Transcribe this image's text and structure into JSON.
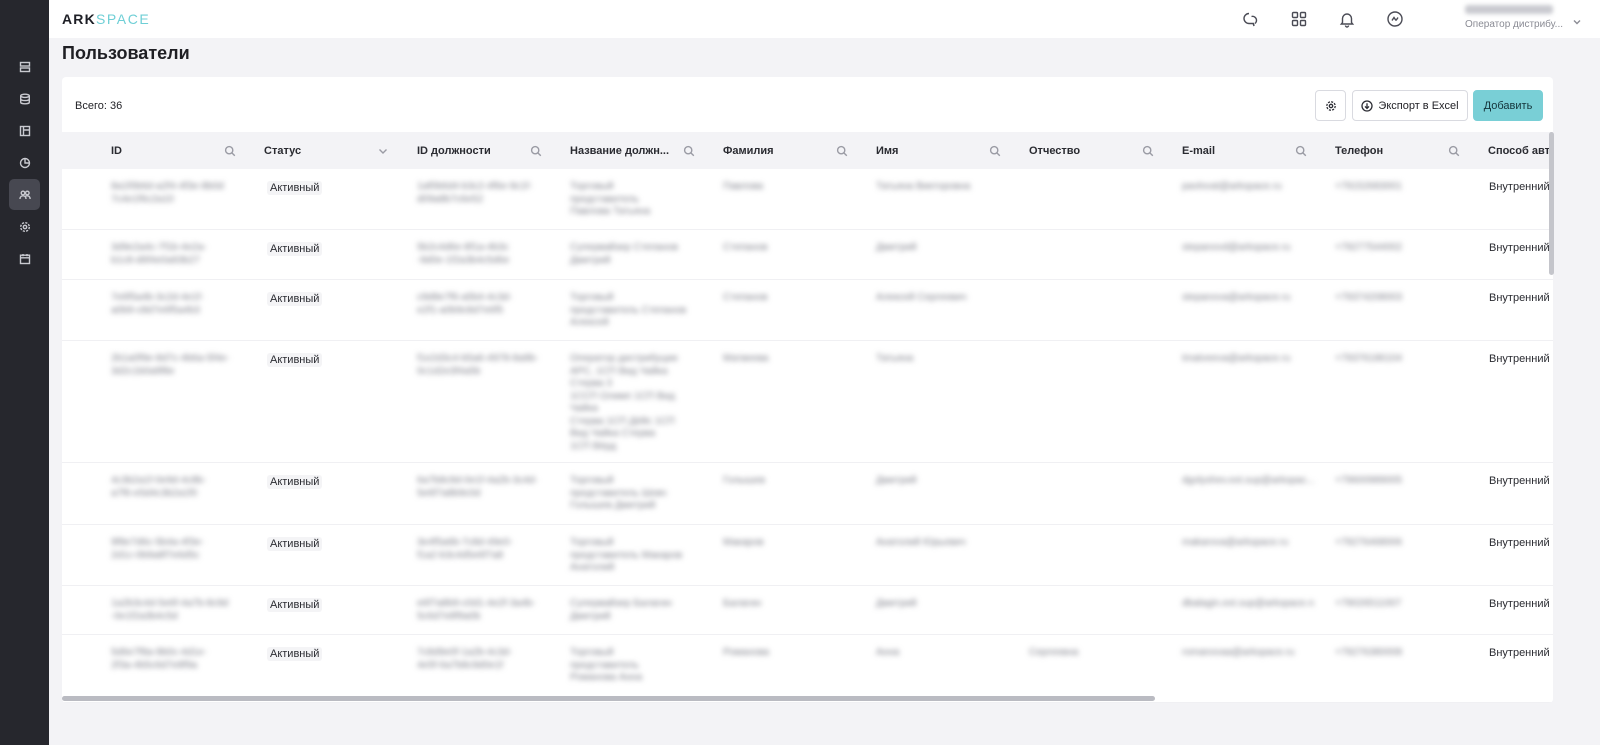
{
  "app": {
    "logo_part1": "ARK",
    "logo_part2": "SPACE",
    "accent": "#6fcfd6"
  },
  "sidebar": {
    "items": [
      {
        "icon": "servers-icon",
        "active": false
      },
      {
        "icon": "database-icon",
        "active": false
      },
      {
        "icon": "layout-icon",
        "active": false
      },
      {
        "icon": "pie-chart-icon",
        "active": false
      },
      {
        "icon": "users-icon",
        "active": true
      },
      {
        "icon": "settings-icon",
        "active": false
      },
      {
        "icon": "calendar-icon",
        "active": false
      }
    ]
  },
  "header": {
    "icons": [
      "chat-icon",
      "apps-grid-icon",
      "bell-icon",
      "sync-icon",
      "chevron-down-icon"
    ],
    "user_role": "Оператор дистрибу..."
  },
  "page": {
    "title": "Пользователи",
    "total": "Всего: 36"
  },
  "toolbar": {
    "export_label": "Экспорт в Excel",
    "add_label": "Добавить"
  },
  "table": {
    "columns": [
      "ID",
      "Статус",
      "ID должности",
      "Название должн...",
      "Фамилия",
      "Имя",
      "Отчество",
      "E-mail",
      "Телефон",
      "Способ авто"
    ],
    "rows": [
      {
        "id": "8a1f0b6d-a2f4-4f3e-8b0d\n7c4e1f6c2a10",
        "status": "Активный",
        "pos_id": "1af0b6d4-b3c2-4f6e-9c1f-\nd09a8b7c6e52",
        "pos_name": "Торговый\nпредставитель\nПавлова Татьяна",
        "last": "Павлова",
        "first": "Татьяна Викторовна",
        "middle": "",
        "email": "pavlovat@arkspace.ru",
        "phone": "+79152683001",
        "auth": "Внутренний"
      },
      {
        "id": "3d9e2a4c-7f1b-4e2a-\nb1c8-d6f4e0a93b27",
        "status": "Активный",
        "pos_id": "5b2c4d6e-8f1a-4b3c\n-9d0e-1f2a3b4c5d6e",
        "pos_name": "Супервайзер Степанов\nДмитрий",
        "last": "Степанов",
        "first": "Дмитрий",
        "middle": "",
        "email": "stepanovd@arkspace.ru",
        "phone": "+79277544002",
        "auth": "Внутренний"
      },
      {
        "id": "7e6f5a4b-3c2d-4e1f-\na0b9-c8d7e6f5a4b3",
        "status": "Активный",
        "pos_id": "c9d8e7f6-a5b4-4c3d-\ne2f1-a0b9c8d7e6f5",
        "pos_name": "Торговый\nпредставитель Степанов\nАлексей",
        "last": "Степанов",
        "first": "Алексей Сергеевич",
        "middle": "",
        "email": "stepanova@arkspace.ru",
        "phone": "+79374208003",
        "auth": "Внутренний"
      },
      {
        "id": "2b1a0f9e-8d7c-4b6a-5f4e-\n3d2c1b0a9f8e",
        "status": "Активный",
        "pos_id": "f1e2d3c4-b5a6-4978-8a9b-\n0c1d2e3f4a5b",
        "pos_name": "Оператор дистрибуции\nАРС, 1СП Вид Чайка\nСтерва 3\n1ССП Олимп 1СП Вид\nЧайка\nСтерва 1СП Дёйс 1СП\nВид Чайка Стерва\n1СП Вёрд",
        "last": "Матвеева",
        "first": "Татьяна",
        "middle": "",
        "email": "tmatveeva@arkspace.ru",
        "phone": "+79376186104",
        "auth": "Внутренний"
      },
      {
        "id": "4c3b2a1f-0e9d-4c8b-\na7f6-e5d4c3b2a1f0",
        "status": "Активный",
        "pos_id": "6a7b8c9d-0e1f-4a2b-3c4d-\n5e6f7a8b9c0d",
        "pos_name": "Торговый\nпредставитель Шевч\nГолышев Дмитрий",
        "last": "Голышев",
        "first": "Дмитрий",
        "middle": "",
        "email": "dgolyshev.ext.sup@arkspac...",
        "phone": "+79600989005",
        "auth": "Внутренний"
      },
      {
        "id": "9f8e7d6c-5b4a-4f3e-\n2d1c-0b9a8f7e6d5c",
        "status": "Активный",
        "pos_id": "3e4f5a6b-7c8d-49e0-\nf1a2-b3c4d5e6f7a8",
        "pos_name": "Торговый\nпредставитель Макаров\nАнатолий",
        "last": "Макаров",
        "first": "Анатолий Юрьевич",
        "middle": "",
        "email": "makarova@arkspace.ru",
        "phone": "+79276468006",
        "auth": "Внутренний"
      },
      {
        "id": "1a2b3c4d-5e6f-4a7b-8c9d\n-0e1f2a3b4c5d",
        "status": "Активный",
        "pos_id": "e6f7a8b9-c0d1-4e2f-3a4b-\n5c6d7e8f9a0b",
        "pos_name": "Супервайзер Балагин\nДмитрий",
        "last": "Балагин",
        "first": "Дмитрий",
        "middle": "",
        "email": "dbalagin.ext.sup@arkspace.ru",
        "phone": "+79026511007",
        "auth": "Внутренний"
      },
      {
        "id": "5d6e7f8a-9b0c-4d1e-\n2f3a-4b5c6d7e8f9a",
        "status": "Активный",
        "pos_id": "7c8d9e0f-1a2b-4c3d-\n4e5f-6a7b8c9d0e1f",
        "pos_name": "Торговый\nпредставитель\nРоманова Анна",
        "last": "Романова",
        "first": "Анна",
        "middle": "Сергеевна",
        "email": "romanovaa@arkspace.ru",
        "phone": "+79276380008",
        "auth": "Внутренний"
      }
    ]
  }
}
